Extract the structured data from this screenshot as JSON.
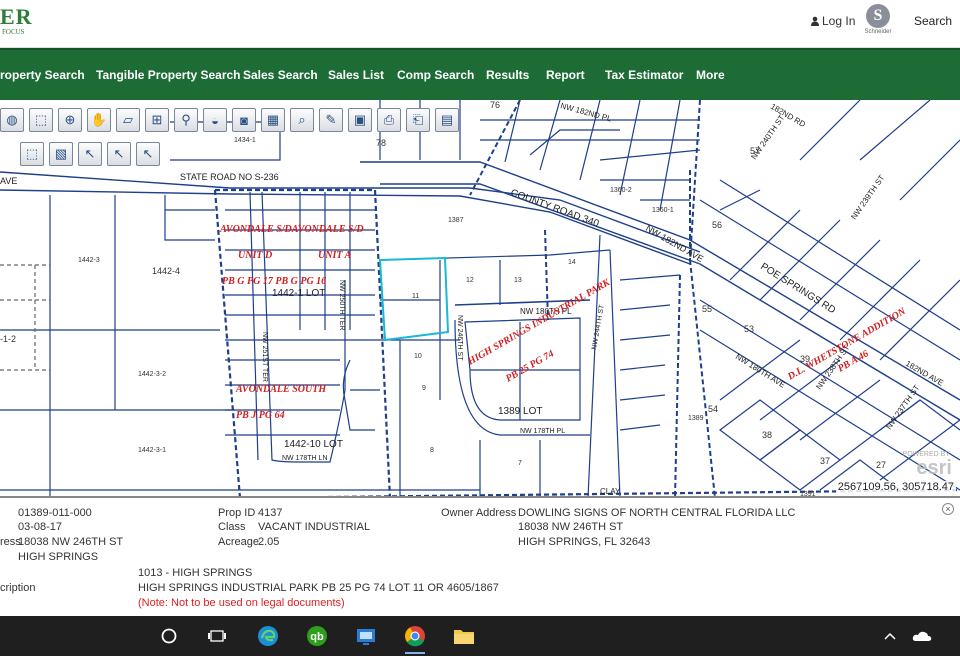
{
  "header": {
    "logo_text": "ER",
    "logo_sub": "FOCUS",
    "login_label": "Log In",
    "schneider_label": "Schneider",
    "search_label": "Search"
  },
  "nav": {
    "items": [
      "roperty Search",
      "Tangible Property Search",
      "Sales Search",
      "Sales List",
      "Comp Search",
      "Results",
      "Report",
      "Tax Estimator",
      "More"
    ]
  },
  "map": {
    "toolbar_icons": [
      "globe-icon",
      "select-rect-icon",
      "zoom-in-icon",
      "pan-hand-icon",
      "eraser-icon",
      "add-icon",
      "pin-icon",
      "layers-icon",
      "camera-icon",
      "measure-icon",
      "zoom-tool-icon",
      "draw-icon",
      "window-icon",
      "print-icon",
      "print2-icon",
      "save-icon"
    ],
    "toolbar2_icons": [
      "select-box-icon",
      "map-view-icon",
      "pointer-icon",
      "pointer2-icon",
      "pointer3-icon"
    ],
    "coordinates": "2567109.56, 305718.47",
    "basemap_credit": "esri",
    "labels": {
      "state_road": "STATE ROAD NO S-236",
      "ave_left": "AVE",
      "county_road": "COUNTY ROAD 340",
      "nw182_ave": "NW 182ND AVE",
      "nw182_pl": "NW 182ND PL",
      "nw182_rd": "182ND RD",
      "nw180_pl": "NW 180TH PL",
      "nw178_pl": "NW 178TH PL",
      "nw178_ln": "NW 178TH LN",
      "nw246_st": "NW 246TH ST",
      "nw244_st": "NW 244TH ST",
      "nw251_ter": "NW 251ST TER",
      "nw250_ter": "NW 250TH TER",
      "poe_springs": "POE SPRINGS RD",
      "nw180_ave": "NW 180TH AVE",
      "nw240_st": "NW 240TH ST",
      "nw239_st": "NW 239TH ST",
      "nw237_st": "NW 237TH ST",
      "nw238_st": "NW 238TH ST",
      "nw182nd_ave_r": "182ND AVE",
      "clay": "CLAY",
      "avondale_sd": "AVONDALE S/DAVONDALE S/D",
      "unit_d": "UNIT  D",
      "unit_a": "UNIT  A",
      "pb_g": "PB   G   PG   17 PB   G   PG   16",
      "avondale_south": "AVONDALE  SOUTH",
      "pb_j": "PB   J   PG   64",
      "lot_1442_1": "1442-1 LOT",
      "lot_1442_10": "1442-10 LOT",
      "lot_1389": "1389 LOT",
      "hs_park": "HIGH SPRINGS INDUSTRIAL PARK",
      "pb25": "PB 25 PG 74",
      "dl_addition": "D.L. WHETSTONE ADDITION",
      "pb_a": "PB   A   46",
      "p1442_4": "1442-4",
      "p1442_3": "1442-3",
      "p1442_3_2": "1442-3-2",
      "p1442_3_1": "1442-3-1",
      "p1_2": "-1-2",
      "p1387": "1387",
      "p1360_2": "1360-2",
      "p1360_1": "1360-1",
      "p1434_1": "1434-1",
      "p1389": "1389",
      "p11": "11",
      "p12": "12",
      "p13": "13",
      "p14": "14",
      "p10": "10",
      "p9": "9",
      "p8": "8",
      "p7": "7",
      "p53": "53",
      "p54": "54",
      "p55": "55",
      "p56": "56",
      "p57": "57",
      "p76": "76",
      "p78": "78",
      "p39": "39",
      "p38": "38",
      "p37": "37",
      "p27": "27",
      "p1391": "1391"
    }
  },
  "info": {
    "parcel": "01389-011-000",
    "date": "03-08-17",
    "address_label": "ress",
    "address": "18038 NW 246TH ST",
    "city": "HIGH SPRINGS",
    "prop_id_label": "Prop ID",
    "prop_id": "4137",
    "class_label": "Class",
    "class_value": "VACANT INDUSTRIAL",
    "acreage_label": "Acreage",
    "acreage": "2.05",
    "owner_label": "Owner Address",
    "owner_name": "DOWLING SIGNS OF NORTH CENTRAL FLORIDA LLC",
    "owner_street": "18038 NW 246TH ST",
    "owner_city": "HIGH SPRINGS, FL 32643",
    "description_label": "cription",
    "district": "1013 - HIGH SPRINGS",
    "legal": "HIGH SPRINGS INDUSTRIAL PARK PB 25 PG 74 LOT 11 OR 4605/1867",
    "note": "(Note: Not to be used on legal documents)"
  },
  "taskbar": {
    "icons": [
      "cortana-icon",
      "task-view-icon",
      "edge-icon",
      "quickbooks-icon",
      "remote-desktop-icon",
      "chrome-icon",
      "file-explorer-icon"
    ],
    "tray_icons": [
      "chevron-up-icon",
      "onedrive-icon"
    ]
  }
}
